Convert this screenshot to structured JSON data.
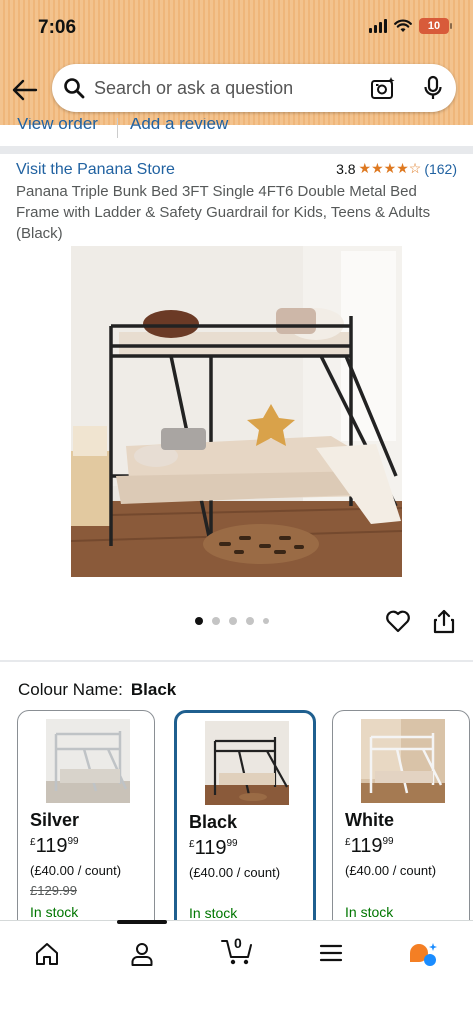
{
  "status_bar": {
    "time": "7:06",
    "battery": "10"
  },
  "search": {
    "placeholder": "Search or ask a question"
  },
  "top_links": {
    "view_order": "View order",
    "add_review": "Add a review"
  },
  "product": {
    "store_link": "Visit the Panana Store",
    "rating_value": "3.8",
    "stars": "★★★★☆",
    "rating_count": "(162)",
    "title": "Panana Triple Bunk Bed 3FT Single 4FT6 Double Metal Bed Frame with Ladder & Safety Guardrail for Kids, Teens & Adults (Black)",
    "image_pager": {
      "count": 5,
      "active": 1
    }
  },
  "variation": {
    "label": "Colour Name:",
    "selected": "Black",
    "options": [
      {
        "name": "Silver",
        "currency": "£",
        "whole": "119",
        "fraction": "99",
        "unit_price": "(£40.00 / count)",
        "was_price": "£129.99",
        "stock": "In stock"
      },
      {
        "name": "Black",
        "currency": "£",
        "whole": "119",
        "fraction": "99",
        "unit_price": "(£40.00 / count)",
        "was_price": "",
        "stock": "In stock"
      },
      {
        "name": "White",
        "currency": "£",
        "whole": "119",
        "fraction": "99",
        "unit_price": "(£40.00 / count)",
        "was_price": "",
        "stock": "In stock"
      }
    ]
  },
  "bottom_nav": {
    "cart_count": "0"
  },
  "colors": {
    "link": "#2162a1",
    "stock": "#007600",
    "stars": "#de7921",
    "selected_border": "#1f5f8f",
    "header_bg": "#f3c38e"
  }
}
